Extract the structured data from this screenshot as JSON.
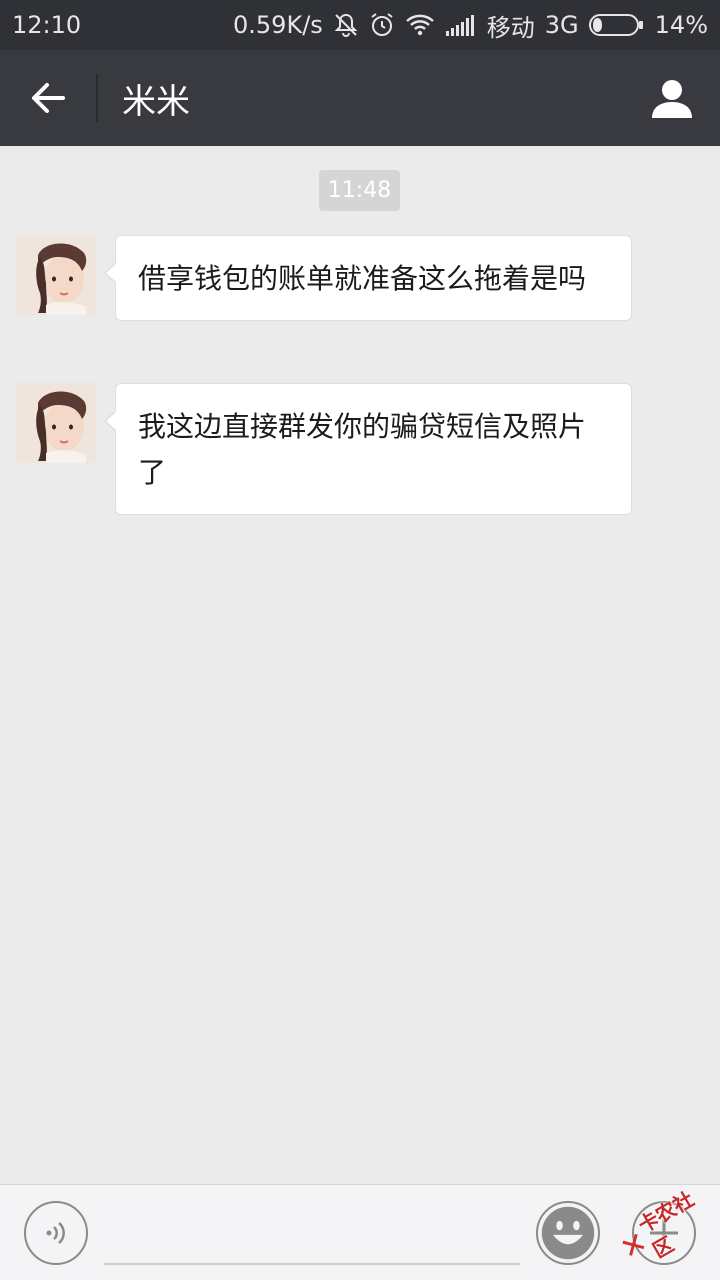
{
  "status_bar": {
    "time": "12:10",
    "net_speed": "0.59K/s",
    "carrier": "移动",
    "network": "3G",
    "battery": "14%"
  },
  "header": {
    "title": "米米",
    "back_icon": "arrow-left-icon",
    "contact_icon": "person-icon"
  },
  "chat": {
    "timestamp": "11:48",
    "messages": [
      {
        "sender": "米米",
        "text": "借享钱包的账单就准备这么拖着是吗"
      },
      {
        "sender": "米米",
        "text": "我这边直接群发你的骗贷短信及照片了"
      }
    ]
  },
  "input": {
    "voice_icon": "voice-icon",
    "emoji_icon": "emoji-icon",
    "plus_icon": "plus-icon",
    "value": ""
  },
  "watermark": {
    "text": "卡农社区"
  },
  "colors": {
    "status_bar_bg": "#2f3136",
    "title_bar_bg": "#393a3f",
    "chat_bg": "#ebebeb",
    "bubble_bg": "#ffffff",
    "watermark_red": "#d32f2f"
  }
}
